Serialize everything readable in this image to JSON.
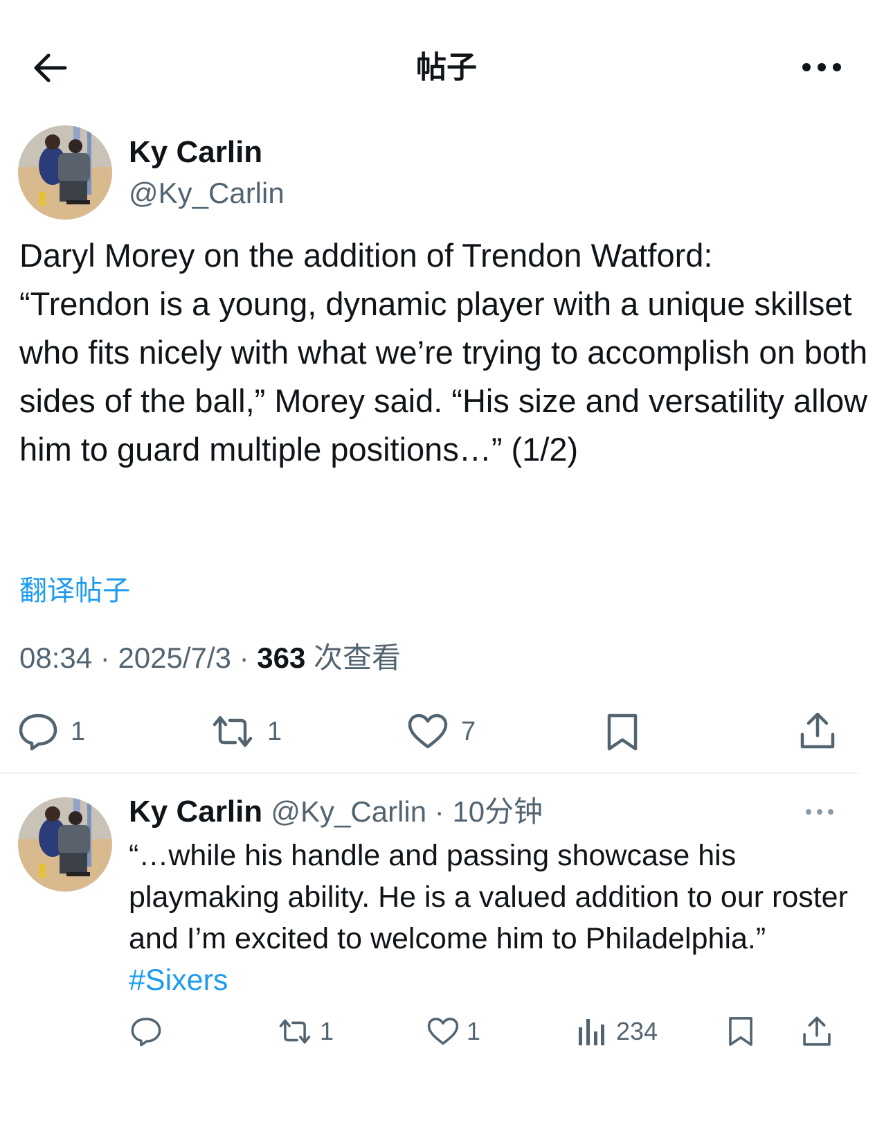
{
  "header": {
    "title": "帖子"
  },
  "post": {
    "author": {
      "name": "Ky Carlin",
      "handle": "@Ky_Carlin"
    },
    "text": "Daryl Morey on the addition of Trendon Watford:\n“Trendon is a young, dynamic player with a unique skillset who fits nicely with what we’re trying to accomplish on both sides of the ball,” Morey said. “His size and versatility allow him to guard multiple positions…” (1/2)",
    "translate_label": "翻译帖子",
    "time": "08:34",
    "sep1": " · ",
    "date": "2025/7/3",
    "sep2": " · ",
    "views_count": "363",
    "views_label": " 次查看",
    "actions": {
      "replies": "1",
      "reposts": "1",
      "likes": "7"
    }
  },
  "reply": {
    "author": {
      "name": "Ky Carlin",
      "handle": "@Ky_Carlin"
    },
    "sep": " · ",
    "time_ago": "10分钟",
    "text": "“…while his handle and passing showcase his playmaking ability. He is a valued addition to our roster and I’m excited to welcome him to Philadelphia.” ",
    "hashtag": "#Sixers",
    "actions": {
      "replies": "",
      "reposts": "1",
      "likes": "1",
      "views": "234"
    }
  },
  "colors": {
    "text_primary": "#0f1419",
    "text_secondary": "#536471",
    "accent": "#1d9bf0",
    "divider": "#eff3f4"
  },
  "icons": {
    "back": "arrow-left-icon",
    "more": "more-horizontal-icon",
    "reply": "chat-bubble-icon",
    "repost": "repost-icon",
    "like": "heart-icon",
    "bookmark": "bookmark-icon",
    "share": "share-icon",
    "views": "bar-chart-icon"
  }
}
